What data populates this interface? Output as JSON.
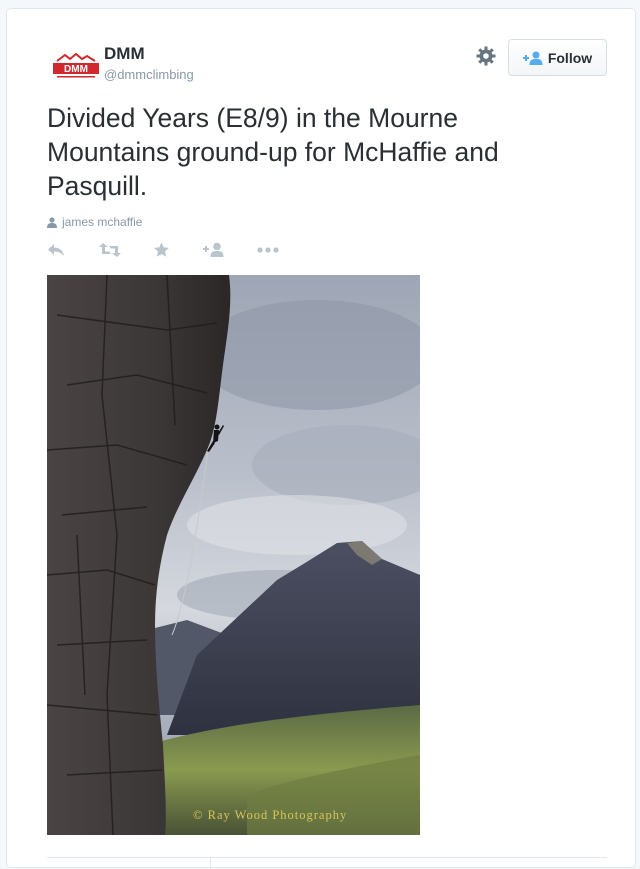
{
  "account": {
    "avatar_text": "DMM",
    "name": "DMM",
    "handle": "@dmmclimbing"
  },
  "buttons": {
    "follow_label": "Follow"
  },
  "tweet": {
    "text": "Divided Years (E8/9) in the Mourne Mountains ground-up for McHaffie and Pasquill.",
    "attribution": "james mchaffie"
  },
  "actions": [
    "reply-icon",
    "retweet-icon",
    "favorite-icon",
    "follow-user-icon",
    "more-icon"
  ],
  "photo": {
    "credit": "© Ray Wood Photography"
  },
  "colors": {
    "brand_red": "#d0282e",
    "follow_blue": "#55acee",
    "muted": "#8899a6",
    "text": "#292f33",
    "icon_gray": "#b9c4cc",
    "credit_gold": "#d8c55a"
  }
}
